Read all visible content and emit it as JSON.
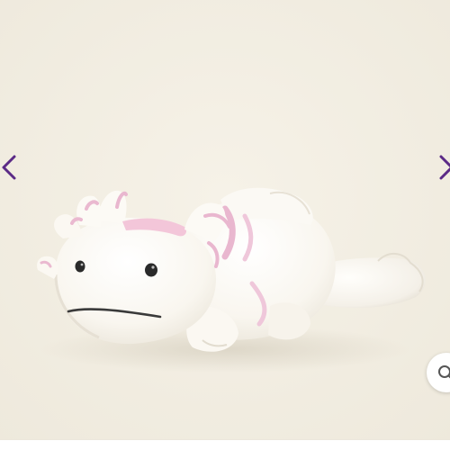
{
  "gallery": {
    "image_subject": "white-axolotl-plush",
    "prev_icon": "chevron-left-icon",
    "next_icon": "chevron-right-icon",
    "zoom_icon": "magnifier-icon",
    "colors": {
      "background": "#f3efe4",
      "arrow": "#5b2a86",
      "plush_body": "#fbf8f2",
      "plush_accent": "#e9b7cf",
      "zoom_button": "#ffffff"
    }
  }
}
